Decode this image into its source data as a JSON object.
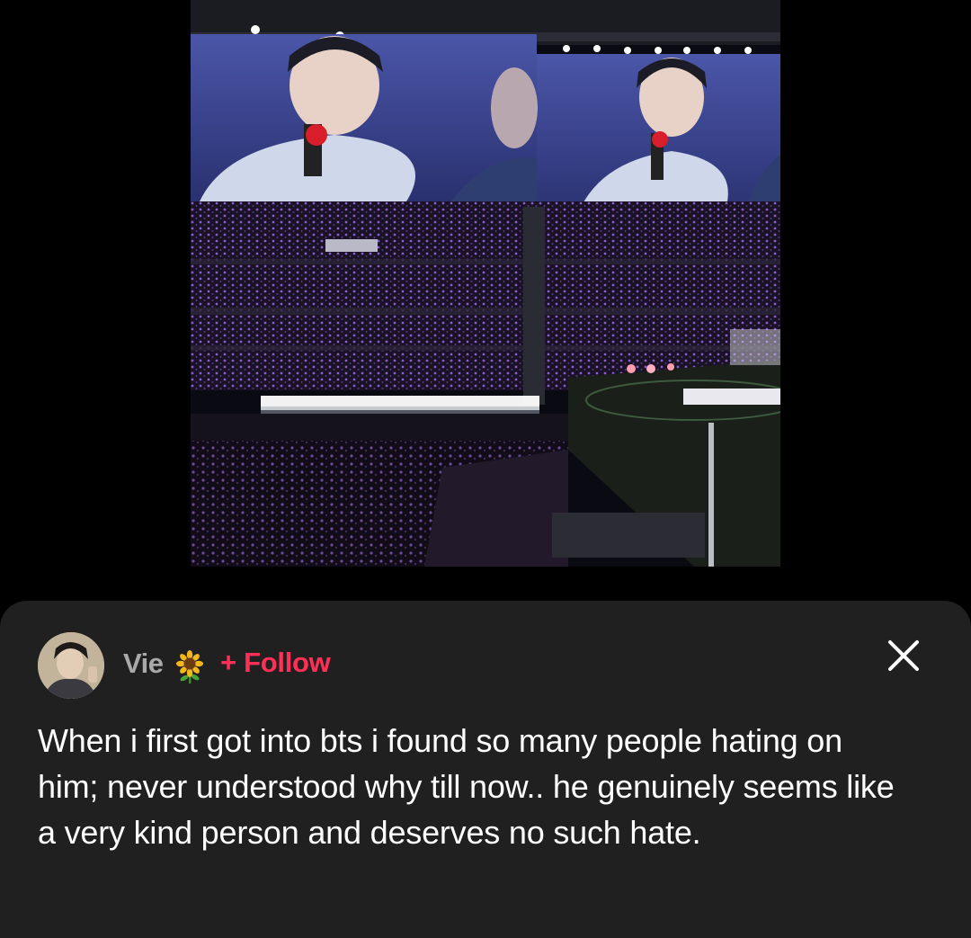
{
  "post": {
    "photo_alt": "Concert stadium photo",
    "author": {
      "name": "Vie",
      "name_emoji": "sunflower-icon",
      "avatar": "avatar"
    },
    "follow_label": "+ Follow",
    "close_icon": "close-icon",
    "caption": "When i first got into bts i found so many people hating on him; never understood why till now.. he genuinely seems like a very kind person and deserves no such hate."
  },
  "colors": {
    "background": "#000000",
    "sheet": "#202020",
    "username": "#a9a9a9",
    "follow": "#ff2f57",
    "caption": "#ffffff"
  }
}
